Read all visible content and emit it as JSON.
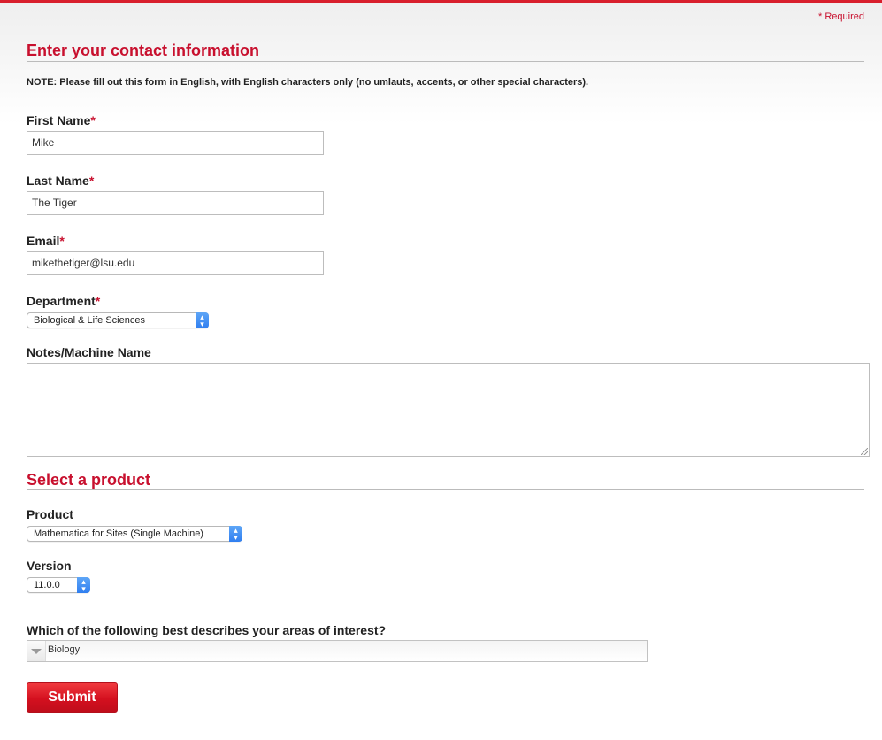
{
  "required_note": "* Required",
  "contact_section": {
    "title": "Enter your contact information",
    "note": "NOTE: Please fill out this form in English, with English characters only (no umlauts, accents, or other special characters)."
  },
  "fields": {
    "first_name": {
      "label": "First Name",
      "value": "Mike"
    },
    "last_name": {
      "label": "Last Name",
      "value": "The Tiger"
    },
    "email": {
      "label": "Email",
      "value": "mikethetiger@lsu.edu"
    },
    "department": {
      "label": "Department",
      "value": "Biological & Life Sciences"
    },
    "notes": {
      "label": "Notes/Machine Name",
      "value": ""
    }
  },
  "required_star": "*",
  "product_section": {
    "title": "Select a product",
    "product": {
      "label": "Product",
      "value": "Mathematica for Sites (Single Machine)"
    },
    "version": {
      "label": "Version",
      "value": "11.0.0"
    },
    "interests": {
      "label": "Which of the following best describes your areas of interest?",
      "value": "Biology"
    }
  },
  "submit_label": "Submit",
  "colors": {
    "accent": "#c8102e",
    "select_arrows": "#3a86f2"
  },
  "icons": {
    "select_arrows": "up-down-chevron-icon",
    "dropdown": "triangle-down-icon",
    "resize": "resize-grip-icon"
  }
}
